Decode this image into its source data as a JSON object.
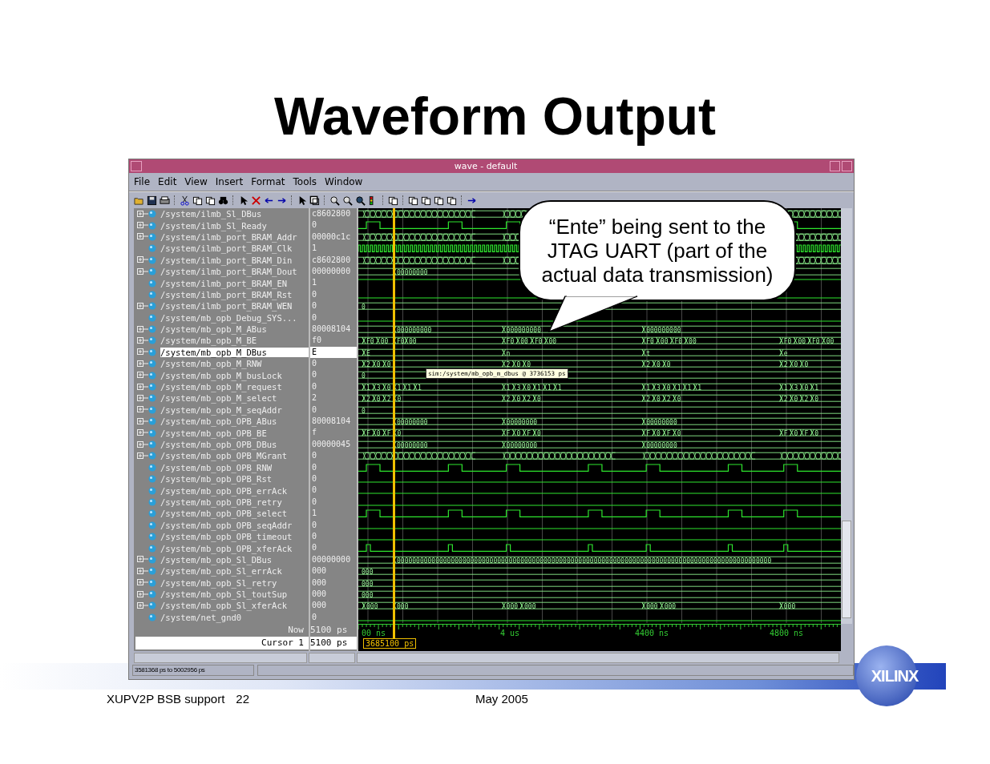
{
  "slide": {
    "title": "Waveform Output",
    "footer_left": "XUPV2P BSB support",
    "page_number": "22",
    "date": "May 2005",
    "logo_text": "XILINX"
  },
  "window": {
    "title": "wave - default"
  },
  "menu": [
    "File",
    "Edit",
    "View",
    "Insert",
    "Format",
    "Tools",
    "Window"
  ],
  "signals": [
    {
      "name": "/system/ilmb_Sl_DBus",
      "value": "c8602800",
      "expandable": true,
      "selected": false,
      "kind": "dense"
    },
    {
      "name": "/system/ilmb_Sl_Ready",
      "value": "0",
      "expandable": true,
      "selected": false,
      "kind": "pulse"
    },
    {
      "name": "/system/ilmb_port_BRAM_Addr",
      "value": "00000c1c",
      "expandable": true,
      "selected": false,
      "kind": "dense"
    },
    {
      "name": "/system/ilmb_port_BRAM_Clk",
      "value": "1",
      "expandable": false,
      "selected": false,
      "kind": "clock"
    },
    {
      "name": "/system/ilmb_port_BRAM_Din",
      "value": "c8602800",
      "expandable": true,
      "selected": false,
      "kind": "dense"
    },
    {
      "name": "/system/ilmb_port_BRAM_Dout",
      "value": "00000000",
      "expandable": true,
      "selected": false,
      "kind": "bus",
      "wave_values": [
        "00000000"
      ]
    },
    {
      "name": "/system/ilmb_port_BRAM_EN",
      "value": "1",
      "expandable": false,
      "selected": false,
      "kind": "high"
    },
    {
      "name": "/system/ilmb_port_BRAM_Rst",
      "value": "0",
      "expandable": false,
      "selected": false,
      "kind": "low"
    },
    {
      "name": "/system/ilmb_port_BRAM_WEN",
      "value": "0",
      "expandable": true,
      "selected": false,
      "kind": "bus",
      "wave_values": [
        "0"
      ]
    },
    {
      "name": "/system/mb_opb_Debug_SYS...",
      "value": "0",
      "expandable": false,
      "selected": false,
      "kind": "low"
    },
    {
      "name": "/system/mb_opb_M_ABus",
      "value": "80008104",
      "expandable": true,
      "selected": false,
      "kind": "bus",
      "wave_values": [
        "000000000",
        "000000000",
        "000000000"
      ]
    },
    {
      "name": "/system/mb_opb_M_BE",
      "value": "f0",
      "expandable": true,
      "selected": false,
      "kind": "bus",
      "wave_values": [
        "F0",
        "00",
        "F0",
        "00",
        "F0",
        "00",
        "F0",
        "00",
        "F0",
        "00",
        "F0",
        "00",
        "F0",
        "00",
        "F0",
        "00"
      ]
    },
    {
      "name": "/system/mb_opb_M_DBus",
      "value": "E",
      "expandable": true,
      "selected": true,
      "kind": "bus",
      "wave_values": [
        "E",
        "n",
        "t",
        "e"
      ]
    },
    {
      "name": "/system/mb_opb_M_RNW",
      "value": "0",
      "expandable": true,
      "selected": false,
      "kind": "bus",
      "wave_values": [
        "2",
        "0",
        "0",
        "2",
        "0",
        "0",
        "2",
        "0",
        "0",
        "2",
        "0",
        "0"
      ]
    },
    {
      "name": "/system/mb_opb_M_busLock",
      "value": "0",
      "expandable": true,
      "selected": false,
      "kind": "bus",
      "wave_values": [
        "0"
      ]
    },
    {
      "name": "/system/mb_opb_M_request",
      "value": "0",
      "expandable": true,
      "selected": false,
      "kind": "bus",
      "wave_values": [
        "1",
        "3",
        "0",
        "1",
        "1",
        "1",
        "1",
        "3",
        "0",
        "1",
        "1",
        "1",
        "1",
        "3",
        "0",
        "1",
        "1",
        "1",
        "1",
        "3",
        "0",
        "1"
      ]
    },
    {
      "name": "/system/mb_opb_M_select",
      "value": "2",
      "expandable": true,
      "selected": false,
      "kind": "bus",
      "wave_values": [
        "2",
        "0",
        "2",
        "0",
        "2",
        "0",
        "2",
        "0",
        "2",
        "0",
        "2",
        "0",
        "2",
        "0",
        "2",
        "0"
      ]
    },
    {
      "name": "/system/mb_opb_M_seqAddr",
      "value": "0",
      "expandable": true,
      "selected": false,
      "kind": "bus",
      "wave_values": [
        "0"
      ]
    },
    {
      "name": "/system/mb_opb_OPB_ABus",
      "value": "80008104",
      "expandable": true,
      "selected": false,
      "kind": "bus",
      "wave_values": [
        "00000000",
        "00000000",
        "00000000"
      ]
    },
    {
      "name": "/system/mb_opb_OPB_BE",
      "value": "f",
      "expandable": true,
      "selected": false,
      "kind": "bus",
      "wave_values": [
        "F",
        "0",
        "F",
        "0",
        "F",
        "0",
        "F",
        "0",
        "F",
        "0",
        "F",
        "0",
        "F",
        "0",
        "F",
        "0"
      ]
    },
    {
      "name": "/system/mb_opb_OPB_DBus",
      "value": "00000045",
      "expandable": true,
      "selected": false,
      "kind": "bus",
      "wave_values": [
        "00000000",
        "00000000",
        "00000000"
      ]
    },
    {
      "name": "/system/mb_opb_OPB_MGrant",
      "value": "0",
      "expandable": true,
      "selected": false,
      "kind": "dense"
    },
    {
      "name": "/system/mb_opb_OPB_RNW",
      "value": "0",
      "expandable": false,
      "selected": false,
      "kind": "pulse"
    },
    {
      "name": "/system/mb_opb_OPB_Rst",
      "value": "0",
      "expandable": false,
      "selected": false,
      "kind": "low"
    },
    {
      "name": "/system/mb_opb_OPB_errAck",
      "value": "0",
      "expandable": false,
      "selected": false,
      "kind": "low"
    },
    {
      "name": "/system/mb_opb_OPB_retry",
      "value": "0",
      "expandable": false,
      "selected": false,
      "kind": "low"
    },
    {
      "name": "/system/mb_opb_OPB_select",
      "value": "1",
      "expandable": false,
      "selected": false,
      "kind": "pulse"
    },
    {
      "name": "/system/mb_opb_OPB_seqAddr",
      "value": "0",
      "expandable": false,
      "selected": false,
      "kind": "low"
    },
    {
      "name": "/system/mb_opb_OPB_timeout",
      "value": "0",
      "expandable": false,
      "selected": false,
      "kind": "low"
    },
    {
      "name": "/system/mb_opb_OPB_xferAck",
      "value": "0",
      "expandable": false,
      "selected": false,
      "kind": "spike"
    },
    {
      "name": "/system/mb_opb_Sl_DBus",
      "value": "00000000",
      "expandable": true,
      "selected": false,
      "kind": "bus",
      "wave_values": [
        "0000000000000000000000000000000000000000000000000000000000000000000000000000000000000000000000000"
      ]
    },
    {
      "name": "/system/mb_opb_Sl_errAck",
      "value": "000",
      "expandable": true,
      "selected": false,
      "kind": "bus",
      "wave_values": [
        "000"
      ]
    },
    {
      "name": "/system/mb_opb_Sl_retry",
      "value": "000",
      "expandable": true,
      "selected": false,
      "kind": "bus",
      "wave_values": [
        "000"
      ]
    },
    {
      "name": "/system/mb_opb_Sl_toutSup",
      "value": "000",
      "expandable": true,
      "selected": false,
      "kind": "bus",
      "wave_values": [
        "000"
      ]
    },
    {
      "name": "/system/mb_opb_Sl_xferAck",
      "value": "000",
      "expandable": true,
      "selected": false,
      "kind": "bus",
      "wave_values": [
        "000",
        "000",
        "000",
        "000",
        "000",
        "000",
        "000"
      ]
    },
    {
      "name": "/system/net_gnd0",
      "value": "0",
      "expandable": false,
      "selected": false,
      "kind": "low"
    }
  ],
  "cursors": [
    {
      "label": "Now",
      "value": "5100 ps",
      "selected": false
    },
    {
      "label": "Cursor 1",
      "value": "5100 ps",
      "selected": true
    }
  ],
  "time_axis": [
    "00 ns",
    "4 us",
    "4400 ns",
    "4800 ns"
  ],
  "cursor_time": "3685100 ps",
  "tooltip": "sim:/system/mb_opb_m_dbus @ 3736153 ps",
  "callout": "“Ente” being sent to the JTAG UART (part of the actual data transmission)",
  "status": "3581368 ps to 5002956 ps"
}
